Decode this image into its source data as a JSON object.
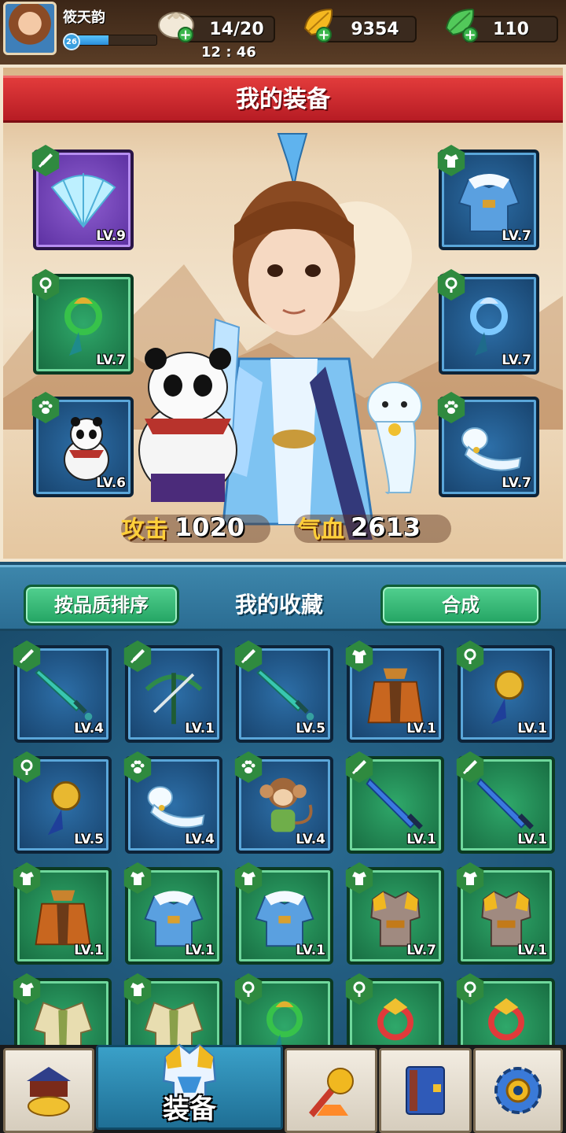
{
  "player": {
    "name": "筱天韵",
    "level": "26",
    "xp_fraction": 0.42
  },
  "resources": {
    "stamina": {
      "icon": "bun-icon",
      "value": "14/20"
    },
    "gold": {
      "icon": "gold-leaf-icon",
      "value": "9354"
    },
    "jade": {
      "icon": "jade-leaf-icon",
      "value": "110"
    }
  },
  "timer": "12 : 46",
  "equipment": {
    "title": "我的装备",
    "slots": [
      {
        "name": "fan-slot",
        "type": "sword-type-icon",
        "level": "LV.9",
        "rarity": "purple"
      },
      {
        "name": "robe-slot",
        "type": "armor-type-icon",
        "level": "LV.7",
        "rarity": "blue"
      },
      {
        "name": "dragon-pendant-slot",
        "type": "pendant-type-icon",
        "level": "LV.7",
        "rarity": "green"
      },
      {
        "name": "qilin-pendant-slot",
        "type": "pendant-type-icon",
        "level": "LV.7",
        "rarity": "blue"
      },
      {
        "name": "panda-pet-slot",
        "type": "paw-type-icon",
        "level": "LV.6",
        "rarity": "blue"
      },
      {
        "name": "ferret-pet-slot",
        "type": "paw-type-icon",
        "level": "LV.7",
        "rarity": "blue"
      }
    ],
    "attack": {
      "label": "攻击",
      "value": "1020"
    },
    "hp": {
      "label": "气血",
      "value": "2613"
    }
  },
  "collection": {
    "sort_button": "按品质排序",
    "title": "我的收藏",
    "merge_button": "合成",
    "items": [
      {
        "art": "dagger",
        "type": "sword-type-icon",
        "level": "LV.4",
        "rarity": "blue"
      },
      {
        "art": "crossbow",
        "type": "sword-type-icon",
        "level": "LV.1",
        "rarity": "blue"
      },
      {
        "art": "dagger",
        "type": "sword-type-icon",
        "level": "LV.5",
        "rarity": "blue"
      },
      {
        "art": "cloak-orange",
        "type": "armor-type-icon",
        "level": "LV.1",
        "rarity": "blue"
      },
      {
        "art": "pendant-gold",
        "type": "pendant-type-icon",
        "level": "LV.1",
        "rarity": "blue"
      },
      {
        "art": "pendant-gold",
        "type": "pendant-type-icon",
        "level": "LV.5",
        "rarity": "blue"
      },
      {
        "art": "ferret",
        "type": "paw-type-icon",
        "level": "LV.4",
        "rarity": "blue"
      },
      {
        "art": "monkey",
        "type": "paw-type-icon",
        "level": "LV.4",
        "rarity": "blue"
      },
      {
        "art": "sword-blue",
        "type": "sword-type-icon",
        "level": "LV.1",
        "rarity": "green"
      },
      {
        "art": "sword-blue",
        "type": "sword-type-icon",
        "level": "LV.1",
        "rarity": "green"
      },
      {
        "art": "cloak-orange",
        "type": "armor-type-icon",
        "level": "LV.1",
        "rarity": "green"
      },
      {
        "art": "robe-blue",
        "type": "armor-type-icon",
        "level": "LV.1",
        "rarity": "green"
      },
      {
        "art": "robe-blue",
        "type": "armor-type-icon",
        "level": "LV.1",
        "rarity": "green"
      },
      {
        "art": "armor-gold",
        "type": "armor-type-icon",
        "level": "LV.7",
        "rarity": "green"
      },
      {
        "art": "armor-gold",
        "type": "armor-type-icon",
        "level": "LV.1",
        "rarity": "green"
      },
      {
        "art": "robe-green",
        "type": "armor-type-icon",
        "level": "",
        "rarity": "green"
      },
      {
        "art": "robe-green",
        "type": "armor-type-icon",
        "level": "",
        "rarity": "green"
      },
      {
        "art": "pendant-green",
        "type": "pendant-type-icon",
        "level": "",
        "rarity": "green"
      },
      {
        "art": "pendant-red",
        "type": "pendant-type-icon",
        "level": "",
        "rarity": "green"
      },
      {
        "art": "pendant-red",
        "type": "pendant-type-icon",
        "level": "",
        "rarity": "green"
      }
    ]
  },
  "nav": [
    {
      "name": "nav-shop",
      "icon": "gold-ingot-shop-icon",
      "label": "",
      "active": false
    },
    {
      "name": "nav-equipment",
      "icon": "armor-icon",
      "label": "装备",
      "active": true
    },
    {
      "name": "nav-battle",
      "icon": "battle-icon",
      "label": "",
      "active": false
    },
    {
      "name": "nav-book",
      "icon": "book-icon",
      "label": "",
      "active": false
    },
    {
      "name": "nav-settings",
      "icon": "gear-icon",
      "label": "",
      "active": false
    }
  ]
}
